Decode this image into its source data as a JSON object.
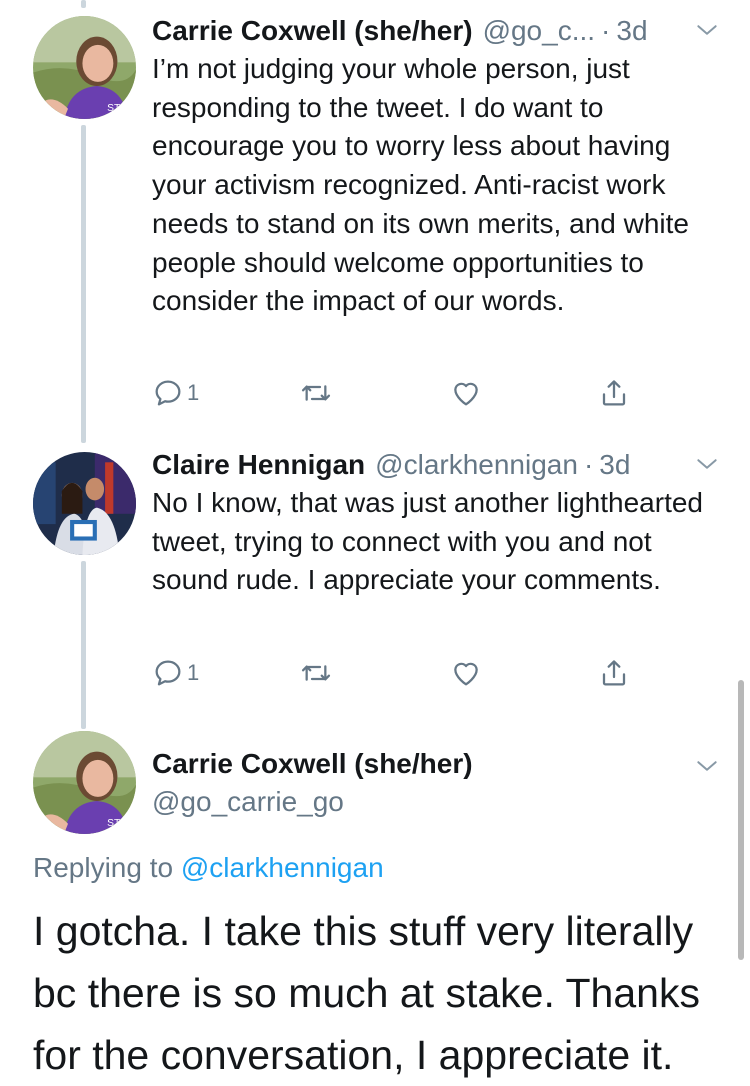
{
  "tweets": [
    {
      "author_name": "Carrie Coxwell (she/her)",
      "author_handle": "@go_c...",
      "separator": "·",
      "time": "3d",
      "text": "I’m not judging your whole person, just responding to the tweet. I do want to encourage you to worry less about having your activism recognized. Anti-racist work needs to stand on its own merits, and white people should welcome opportunities to consider the impact of our words.",
      "reply_count": "1"
    },
    {
      "author_name": "Claire Hennigan",
      "author_handle": "@clarkhennigan",
      "separator": "·",
      "time": "3d",
      "text": "No I know, that was just another lighthearted tweet, trying to connect with you and not sound rude. I appreciate your comments.",
      "reply_count": "1"
    }
  ],
  "focused_tweet": {
    "author_name": "Carrie Coxwell (she/her)",
    "author_handle": "@go_carrie_go",
    "replying_prefix": "Replying to",
    "replying_to": "@clarkhennigan",
    "text": "I gotcha. I take this stuff very literally bc there is so much at stake. Thanks for the conversation, I appreciate it."
  },
  "icons": {
    "reply": "reply-icon",
    "retweet": "retweet-icon",
    "like": "heart-icon",
    "share": "share-icon",
    "menu": "chevron-down-icon"
  },
  "colors": {
    "text": "#14171a",
    "secondary": "#657786",
    "link": "#1da1f2",
    "thread_line": "#ccd6dd"
  }
}
